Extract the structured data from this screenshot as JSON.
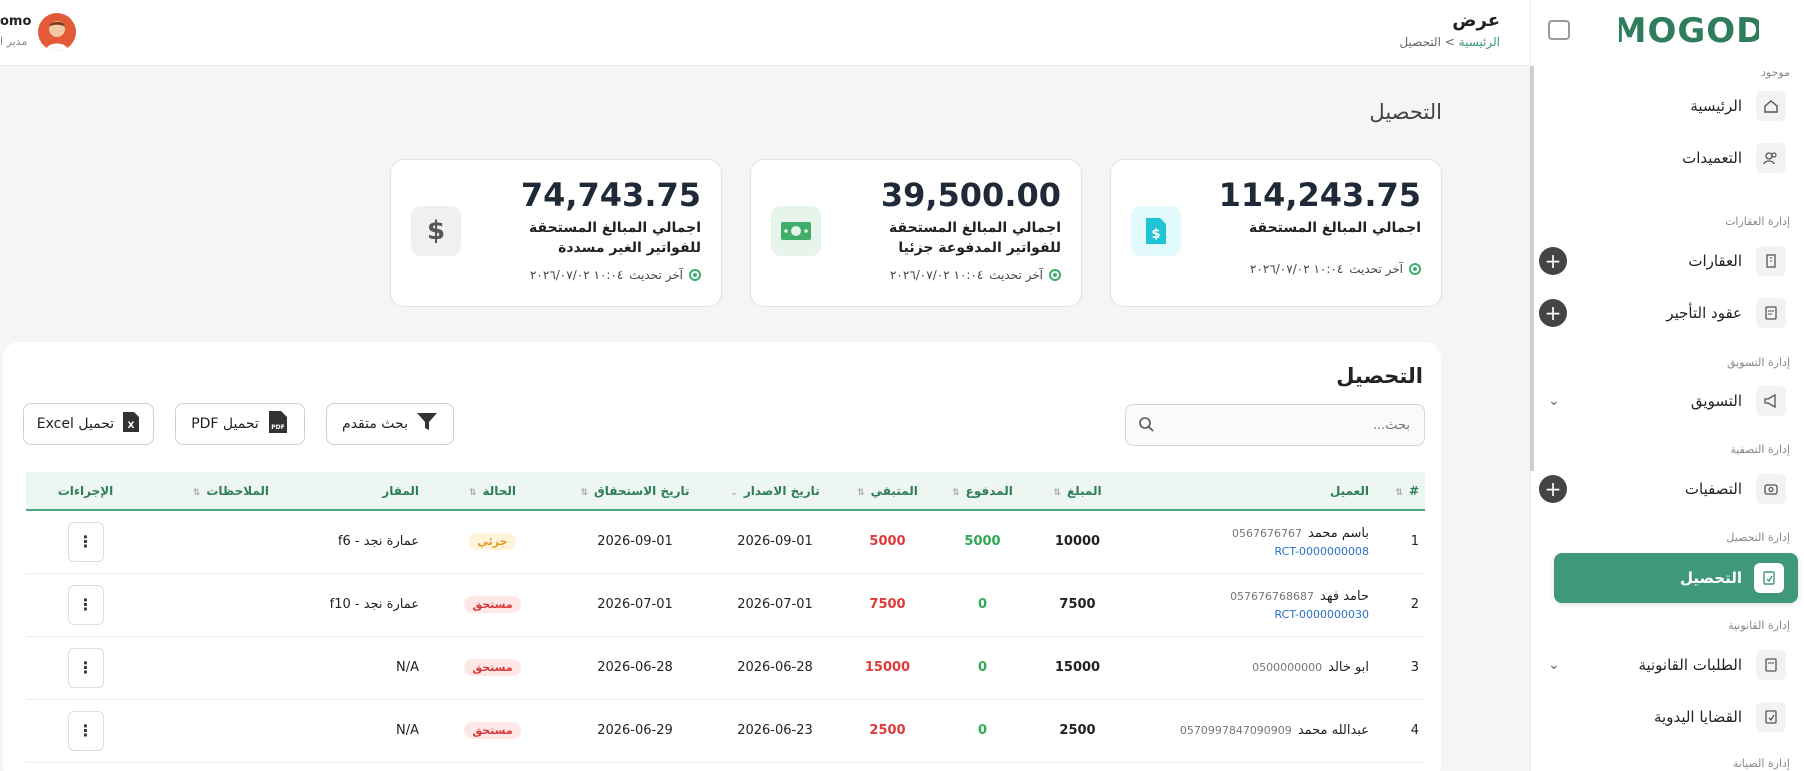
{
  "brand": {
    "logo_text": "MOGOD",
    "accent": "#3f9877"
  },
  "header": {
    "title": "عرض",
    "breadcrumb_home": "الرئيسية",
    "breadcrumb_sep": ">",
    "breadcrumb_current": "التحصيل",
    "user_name": "omo",
    "user_role": "مدير ا"
  },
  "sidebar": {
    "section_main": "موجود",
    "items_main": [
      {
        "label": "الرئيسية",
        "icon": "home-icon"
      },
      {
        "label": "التعميدات",
        "icon": "users-icon"
      }
    ],
    "section_properties": "إدارة العقارات",
    "items_properties": [
      {
        "label": "العقارات",
        "icon": "building-icon"
      },
      {
        "label": "عقود التأجير",
        "icon": "contract-icon"
      }
    ],
    "section_marketing": "إدارة التسويق",
    "marketing_label": "التسويق",
    "section_liquidation": "إدارة التصفية",
    "liquidation_label": "التصفيات",
    "section_collection": "إدارة التحصيل",
    "collection_label": "التحصيل",
    "section_legal": "إدارة القانونية",
    "legal_requests_label": "الطلبات القانونية",
    "manual_cases_label": "القضايا اليدوية",
    "section_maintenance": "إدارة الصيانة"
  },
  "page": {
    "title": "التحصيل"
  },
  "cards": [
    {
      "amount": "114,243.75",
      "title": "اجمالي المبالغ المستحقة",
      "updated_label": "آخر تحديث",
      "updated_value": "١٠:٠٤ ٢٠٢٦/٠٧/٠٢",
      "icon": "invoice-dollar-icon",
      "icon_bg": "#e3fafc",
      "icon_color": "#1fc3d6"
    },
    {
      "amount": "39,500.00",
      "title": "اجمالي المبالغ المستحقة للفواتير المدفوعة جزئيا",
      "updated_label": "آخر تحديث",
      "updated_value": "١٠:٠٤ ٢٠٢٦/٠٧/٠٢",
      "icon": "banknote-icon",
      "icon_bg": "#e6f4ec",
      "icon_color": "#3fae6a"
    },
    {
      "amount": "74,743.75",
      "title": "اجمالي المبالغ المستحقة للفواتير الغير مسددة",
      "updated_label": "آخر تحديث",
      "updated_value": "١٠:٠٤ ٢٠٢٦/٠٧/٠٢",
      "icon": "dollar-icon",
      "icon_bg": "#f0f0f0",
      "icon_color": "#555"
    }
  ],
  "table_panel": {
    "title": "التحصيل",
    "search_placeholder": "بحث...",
    "advanced_search": "بحث متقدم",
    "download_pdf": "تحميل PDF",
    "download_excel": "تحميل Excel",
    "pdf_badge": "PDF",
    "excel_badge": "X"
  },
  "table": {
    "columns": [
      "#",
      "العميل",
      "المبلغ",
      "المدفوع",
      "المتبقي",
      "تاريخ الاصدار",
      "تاريخ الاستحقاق",
      "الحالة",
      "المقار",
      "الملاحظات",
      "الإجراءات"
    ],
    "rows": [
      {
        "no": "1",
        "name": "باسم محمد",
        "phone": "0567676767",
        "ref": "RCT-0000000008",
        "amount": "10000",
        "paid": "5000",
        "remaining": "5000",
        "issue_date": "2026-09-01",
        "due_date": "2026-09-01",
        "status": "جزئي",
        "status_type": "partial",
        "property": "عمارة نجد - f6",
        "notes": ""
      },
      {
        "no": "2",
        "name": "حامد فهد",
        "phone": "057676768687",
        "ref": "RCT-0000000030",
        "amount": "7500",
        "paid": "0",
        "remaining": "7500",
        "issue_date": "2026-07-01",
        "due_date": "2026-07-01",
        "status": "مستحق",
        "status_type": "due",
        "property": "عمارة نجد - f10",
        "notes": ""
      },
      {
        "no": "3",
        "name": "ابو خالد",
        "phone": "0500000000",
        "ref": "",
        "amount": "15000",
        "paid": "0",
        "remaining": "15000",
        "issue_date": "2026-06-28",
        "due_date": "2026-06-28",
        "status": "مستحق",
        "status_type": "due",
        "property": "N/A",
        "notes": ""
      },
      {
        "no": "4",
        "name": "عبدالله محمد",
        "phone": "0570997847090909",
        "ref": "",
        "amount": "2500",
        "paid": "0",
        "remaining": "2500",
        "issue_date": "2026-06-23",
        "due_date": "2026-06-29",
        "status": "مستحق",
        "status_type": "due",
        "property": "N/A",
        "notes": ""
      }
    ]
  }
}
